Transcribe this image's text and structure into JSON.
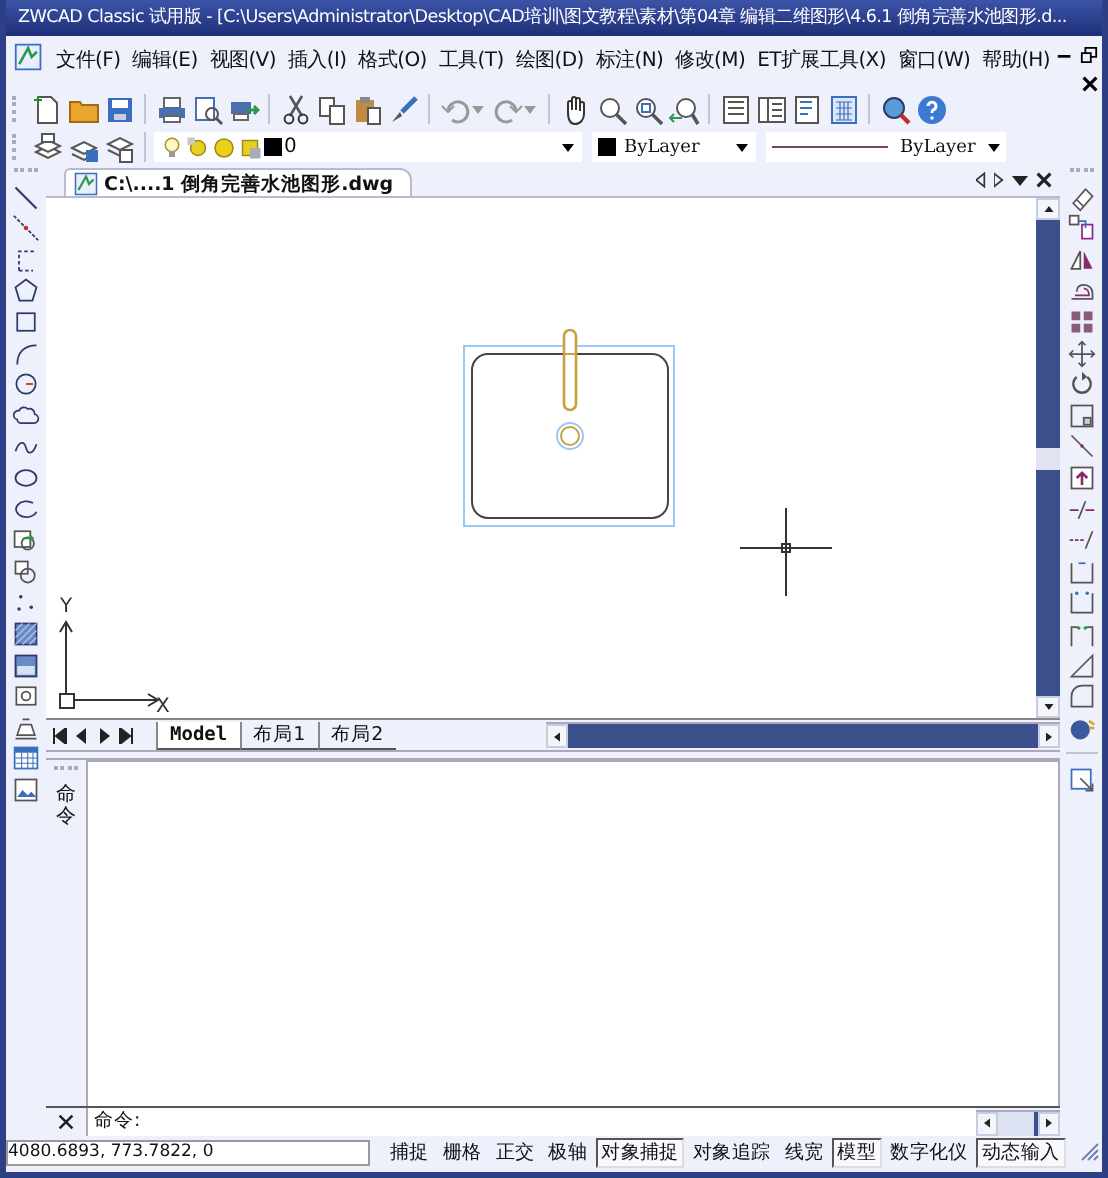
{
  "title_bar": {
    "title": "ZWCAD Classic 试用版 - [C:\\Users\\Administrator\\Desktop\\CAD培训\\图文教程\\素材\\第04章 编辑二维图形\\4.6.1  倒角完善水池图形.d..."
  },
  "menu": [
    "文件(F)",
    "编辑(E)",
    "视图(V)",
    "插入(I)",
    "格式(O)",
    "工具(T)",
    "绘图(D)",
    "标注(N)",
    "修改(M)",
    "ET扩展工具(X)",
    "窗口(W)",
    "帮助(H)"
  ],
  "layer_toolbar": {
    "layer": "0",
    "color_label": "ByLayer",
    "linetype": "ByLayer"
  },
  "document_tab": {
    "label": "C:\\....1  倒角完善水池图形.dwg"
  },
  "ucs": {
    "x_label": "X",
    "y_label": "Y"
  },
  "layout_tabs": [
    {
      "label": "Model",
      "selected": true
    },
    {
      "label": "布局1",
      "selected": false
    },
    {
      "label": "布局2",
      "selected": false
    }
  ],
  "command_panel": {
    "title": "命令",
    "prompt": "命令:"
  },
  "status_bar": {
    "coordinates": "4080.6893,  773.7822,  0",
    "toggles": [
      {
        "label": "捕捉",
        "on": false
      },
      {
        "label": "栅格",
        "on": false
      },
      {
        "label": "正交",
        "on": false
      },
      {
        "label": "极轴",
        "on": false
      },
      {
        "label": "对象捕捉",
        "on": true
      },
      {
        "label": "对象追踪",
        "on": false
      },
      {
        "label": "线宽",
        "on": false
      },
      {
        "label": "模型",
        "on": true
      },
      {
        "label": "数字化仪",
        "on": false
      },
      {
        "label": "动态输入",
        "on": true
      }
    ]
  }
}
